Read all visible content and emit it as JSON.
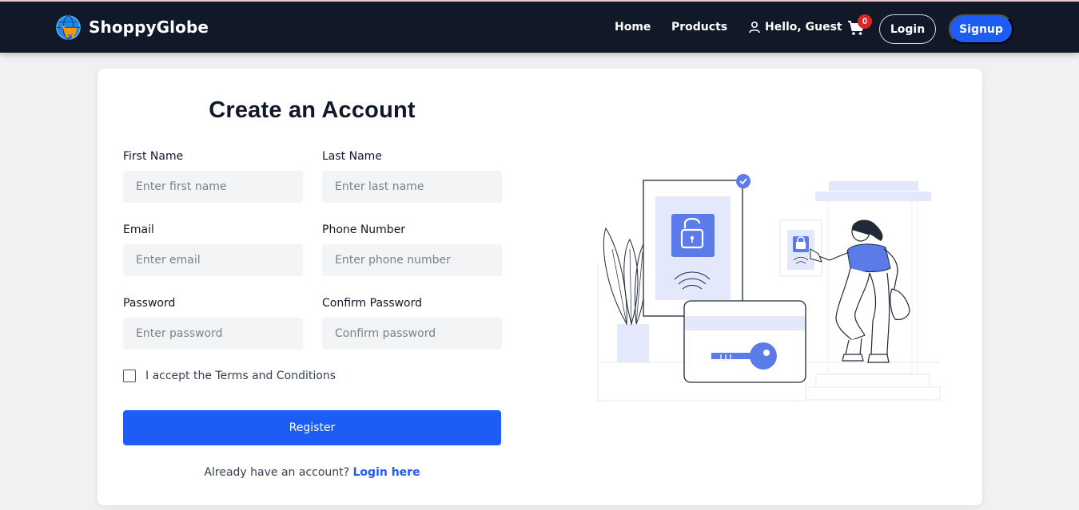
{
  "brand": {
    "name": "ShoppyGlobe",
    "logo_icon": "globe-cart-icon"
  },
  "nav": {
    "home_label": "Home",
    "products_label": "Products",
    "greeting": "Hello, Guest",
    "user_icon": "user-icon",
    "cart_icon": "cart-icon",
    "cart_count": "0",
    "login_label": "Login",
    "signup_label": "Signup"
  },
  "form": {
    "title": "Create an Account",
    "fields": {
      "first_name": {
        "label": "First Name",
        "placeholder": "Enter first name",
        "value": ""
      },
      "last_name": {
        "label": "Last Name",
        "placeholder": "Enter last name",
        "value": ""
      },
      "email": {
        "label": "Email",
        "placeholder": "Enter email",
        "value": ""
      },
      "phone": {
        "label": "Phone Number",
        "placeholder": "Enter phone number",
        "value": ""
      },
      "password": {
        "label": "Password",
        "placeholder": "Enter password",
        "value": ""
      },
      "confirm_password": {
        "label": "Confirm Password",
        "placeholder": "Confirm password",
        "value": ""
      }
    },
    "terms_label": "I accept the Terms and Conditions",
    "terms_checked": false,
    "register_label": "Register",
    "login_prompt": "Already have an account?",
    "login_link": "Login here"
  },
  "illustration": {
    "icon": "secure-access-illustration"
  },
  "colors": {
    "navbar_bg": "#111827",
    "accent": "#1d5cf5",
    "badge": "#e02424",
    "illustration_blue": "#5b7be9",
    "illustration_light": "#e3e9fb"
  }
}
